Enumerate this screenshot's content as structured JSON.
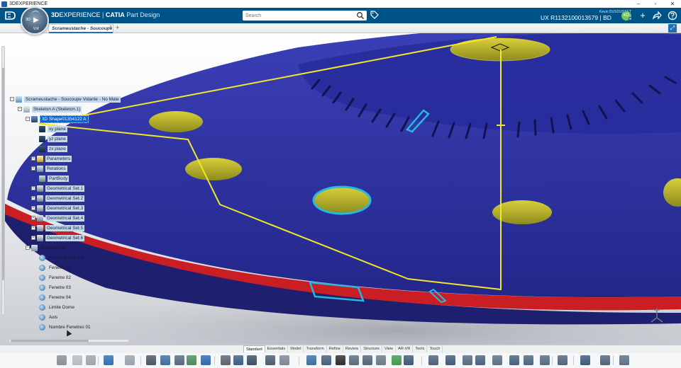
{
  "os_window": {
    "title": "3DEXPERIENCE",
    "controls": [
      "minimize",
      "maximize",
      "close"
    ]
  },
  "header": {
    "brand_bold": "3D",
    "brand_rest": "EXPERIENCE",
    "separator": " | ",
    "app_name": "CATIA",
    "app_role": "Part Design",
    "search_placeholder": "Search",
    "user_name": "Kevin DUSOUSSET",
    "tenant": "UX R1132100013579 | BD",
    "avatar_initials": "KD",
    "accent_color": "#005386",
    "icons": [
      "ds-logo-icon",
      "search-icon",
      "tag-icon",
      "add-icon",
      "share-icon",
      "help-icon"
    ]
  },
  "compass": {
    "label_left": "3D",
    "label_bottom": "V.R"
  },
  "tabs": {
    "doc_tab_label": "Scrameustache - Soucoupe",
    "add_symbol": "+",
    "close_symbol": "×"
  },
  "spec_tree": {
    "root": "Scrameustache - Soucoupe Volante - No Mate",
    "skeleton": "Skeleton A (Skeleton.1)",
    "shape": "3D Shape01354122 A",
    "planes": [
      "xy plane",
      "yz plane",
      "zx plane"
    ],
    "parameters": "Parameters",
    "relations": "Relations",
    "part_body": "PartBody",
    "geometrical_sets": [
      "Geometrical Set.1",
      "Geometrical Set.2",
      "Geometrical Set.3",
      "Geometrical Set.4",
      "Geometrical Set.5",
      "Geometrical Set.6"
    ],
    "publications": "Publications",
    "publication_items": [
      "Forme Soucoupe",
      "Fenetre 01",
      "Fenetre 02",
      "Fenetre 03",
      "Fenetre 04",
      "Limite Dome",
      "Axis",
      "Nombre Fenetres 01"
    ],
    "selected_item": "3D Shape01354122 A"
  },
  "viewport": {
    "model_color": "#2b2e90",
    "rim_color": "#c91e24",
    "highlight_color": "#f0e62a",
    "preselect_color": "#27b8e0"
  },
  "action_bar": {
    "sections": [
      "Standard",
      "Essentials",
      "Model",
      "Transform",
      "Refine",
      "Review",
      "Structure",
      "View",
      "AR-VR",
      "Tools",
      "Touch"
    ],
    "active_section": "Standard"
  }
}
